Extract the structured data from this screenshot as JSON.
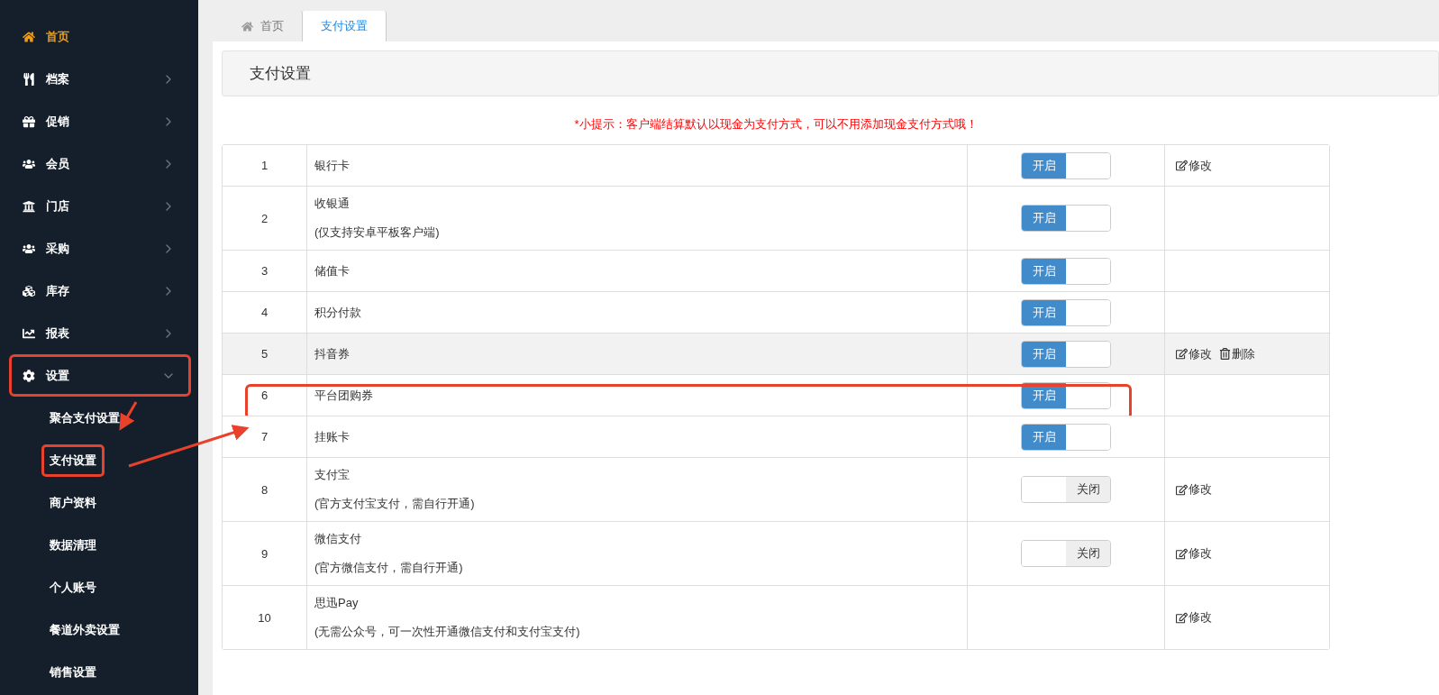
{
  "sidebar": {
    "items": [
      {
        "label": "首页",
        "active": true,
        "annotated": false
      },
      {
        "label": "档案",
        "active": false,
        "expanded": false,
        "annotated": false
      },
      {
        "label": "促销",
        "active": false,
        "expanded": false,
        "annotated": false
      },
      {
        "label": "会员",
        "active": false,
        "expanded": false,
        "annotated": false
      },
      {
        "label": "门店",
        "active": false,
        "expanded": false,
        "annotated": false
      },
      {
        "label": "采购",
        "active": false,
        "expanded": false,
        "annotated": false
      },
      {
        "label": "库存",
        "active": false,
        "expanded": false,
        "annotated": false
      },
      {
        "label": "报表",
        "active": false,
        "expanded": false,
        "annotated": false
      },
      {
        "label": "设置",
        "active": false,
        "expanded": true,
        "annotated": true,
        "children": [
          {
            "label": "聚合支付设置",
            "annotated": false
          },
          {
            "label": "支付设置",
            "annotated": true
          },
          {
            "label": "商户资料",
            "annotated": false
          },
          {
            "label": "数据清理",
            "annotated": false
          },
          {
            "label": "个人账号",
            "annotated": false
          },
          {
            "label": "餐道外卖设置",
            "annotated": false
          },
          {
            "label": "销售设置",
            "annotated": false
          }
        ]
      }
    ]
  },
  "tabs": [
    {
      "label": "首页",
      "selected": false
    },
    {
      "label": "支付设置",
      "selected": true
    }
  ],
  "panel_title": "支付设置",
  "tip": "*小提示：客户端结算默认以现金为支付方式，可以不用添加现金支付方式哦！",
  "rows": [
    {
      "num": "1",
      "name": "银行卡",
      "toggle": {
        "on": true,
        "label": "开启"
      },
      "hover": false,
      "annotated": false,
      "actions": [
        {
          "kind": "edit",
          "label": "修改"
        }
      ]
    },
    {
      "num": "2",
      "name": "收银通",
      "note": "(仅支持安卓平板客户端)",
      "toggle": {
        "on": true,
        "label": "开启"
      },
      "hover": false,
      "annotated": false
    },
    {
      "num": "3",
      "name": "储值卡",
      "toggle": {
        "on": true,
        "label": "开启"
      },
      "hover": false,
      "annotated": false
    },
    {
      "num": "4",
      "name": "积分付款",
      "toggle": {
        "on": true,
        "label": "开启"
      },
      "hover": false,
      "annotated": false
    },
    {
      "num": "5",
      "name": "抖音券",
      "toggle": {
        "on": true,
        "label": "开启"
      },
      "hover": true,
      "annotated": false,
      "actions": [
        {
          "kind": "edit",
          "label": "修改"
        },
        {
          "kind": "delete",
          "label": "删除"
        }
      ]
    },
    {
      "num": "6",
      "name": "平台团购券",
      "toggle": {
        "on": true,
        "label": "开启"
      },
      "hover": false,
      "annotated": true
    },
    {
      "num": "7",
      "name": "挂账卡",
      "toggle": {
        "on": true,
        "label": "开启"
      },
      "hover": false,
      "annotated": false
    },
    {
      "num": "8",
      "name": "支付宝",
      "note": "(官方支付宝支付，需自行开通)",
      "toggle": {
        "on": false,
        "label": "关闭"
      },
      "hover": false,
      "annotated": false,
      "actions": [
        {
          "kind": "edit",
          "label": "修改"
        }
      ]
    },
    {
      "num": "9",
      "name": "微信支付",
      "note": "(官方微信支付，需自行开通)",
      "toggle": {
        "on": false,
        "label": "关闭"
      },
      "hover": false,
      "annotated": false,
      "actions": [
        {
          "kind": "edit",
          "label": "修改"
        }
      ]
    },
    {
      "num": "10",
      "name": "思迅Pay",
      "note": "(无需公众号，可一次性开通微信支付和支付宝支付)",
      "hover": false,
      "annotated": false,
      "actions": [
        {
          "kind": "edit",
          "label": "修改"
        }
      ]
    }
  ]
}
